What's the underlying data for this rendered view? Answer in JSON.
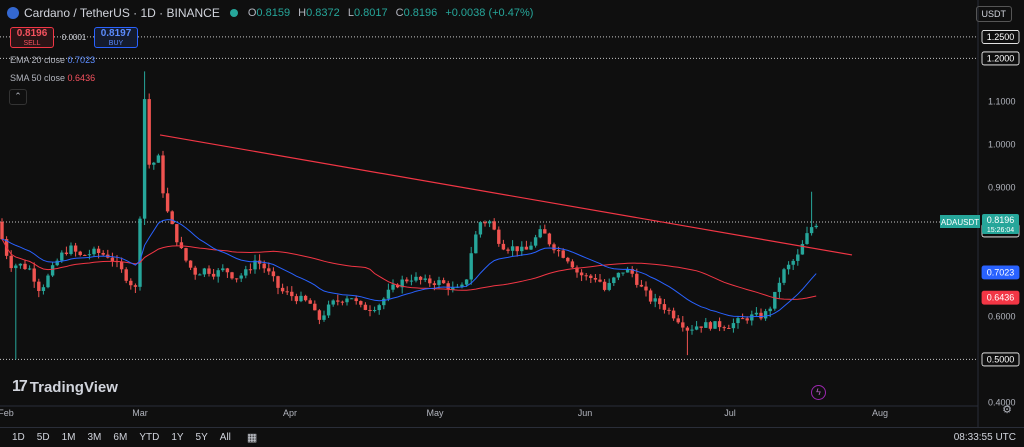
{
  "header": {
    "title": "Cardano / TetherUS · 1D · BINANCE",
    "ohlc": [
      {
        "k": "O",
        "v": "0.8159"
      },
      {
        "k": "H",
        "v": "0.8372"
      },
      {
        "k": "L",
        "v": "0.8017"
      },
      {
        "k": "C",
        "v": "0.8196"
      }
    ],
    "change": "+0.0038 (+0.47%)",
    "currency": "USDT"
  },
  "trade": {
    "sell_price": "0.8196",
    "sell_label": "SELL",
    "spread": "0.0001",
    "buy_price": "0.8197",
    "buy_label": "BUY"
  },
  "indicators": [
    {
      "label": "EMA 20 close",
      "value": "0.7023",
      "color": "#2962ff"
    },
    {
      "label": "SMA 50 close",
      "value": "0.6436",
      "color": "#f23645"
    }
  ],
  "chart_data": {
    "type": "candlestick",
    "symbol": "ADAUSDT",
    "ylim": [
      0.38,
      1.28
    ],
    "y_ticks": [
      "1.2500",
      "1.2000",
      "1.1000",
      "1.0000",
      "0.9000",
      "0.8000",
      "0.6000",
      "0.5000",
      "0.4000"
    ],
    "x_ticks": [
      "Feb",
      "Mar",
      "Apr",
      "May",
      "Jun",
      "Jul",
      "Aug"
    ],
    "horizontal_lines": [
      1.25,
      1.2,
      0.5
    ],
    "current_price": {
      "label": "ADAUSDT",
      "value": "0.8196",
      "countdown": "15:26:04"
    },
    "level_labels": [
      {
        "value": "1.2500",
        "y": 1.25,
        "style": "outline"
      },
      {
        "value": "1.2000",
        "y": 1.2,
        "style": "outline"
      },
      {
        "value": "0.8000",
        "y": 0.8,
        "style": "outline"
      },
      {
        "value": "0.7023",
        "y": 0.7023,
        "style": "ema"
      },
      {
        "value": "0.6436",
        "y": 0.6436,
        "style": "sma"
      },
      {
        "value": "0.5000",
        "y": 0.5,
        "style": "outline"
      }
    ],
    "trendline": [
      {
        "x": 160,
        "y": 1.022
      },
      {
        "x": 852,
        "y": 0.743
      }
    ],
    "candles": [],
    "colors": {
      "up": "#26a69a",
      "down": "#ef5350",
      "ema": "#2962ff",
      "sma": "#f23645",
      "trend": "#f23645"
    }
  },
  "footer": {
    "ranges": [
      "1D",
      "5D",
      "1M",
      "3M",
      "6M",
      "YTD",
      "1Y",
      "5Y",
      "All"
    ],
    "clock": "08:33:55 UTC"
  },
  "branding": {
    "name": "TradingView"
  }
}
